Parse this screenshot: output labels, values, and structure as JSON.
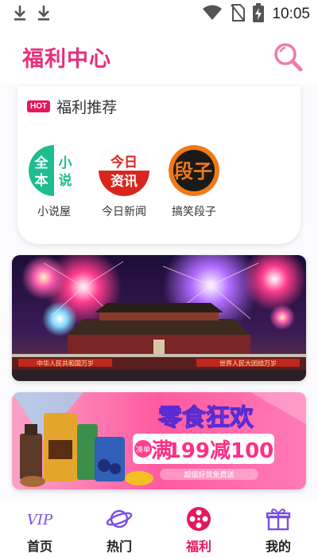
{
  "status_bar": {
    "time": "10:05",
    "icons": [
      "download-icon",
      "download-icon",
      "wifi-icon",
      "no-sim-icon",
      "battery-charging-icon"
    ]
  },
  "header": {
    "title": "福利中心",
    "search_icon": "search-icon"
  },
  "recommend": {
    "badge": "HOT",
    "title": "福利推荐",
    "items": [
      {
        "label": "小说屋",
        "logo_text": [
          "全",
          "小",
          "本",
          "说"
        ]
      },
      {
        "label": "今日新闻",
        "logo_text": [
          "今日",
          "资讯"
        ]
      },
      {
        "label": "搞笑段子",
        "logo_text": [
          "段子"
        ]
      }
    ]
  },
  "banners": [
    {
      "name": "fireworks-banner",
      "gate_sign_left": "中华人民共和国万岁",
      "gate_sign_right": "世界人民大团结万岁"
    },
    {
      "name": "snack-sale-banner",
      "headline": "零食狂欢",
      "deal_prefix": "满",
      "deal_text": "199减100",
      "deal_tag": "凑单",
      "subline": "超值好货免费送"
    }
  ],
  "bottom_nav": [
    {
      "label": "首页",
      "icon_text": "VIP",
      "active": false
    },
    {
      "label": "热门",
      "active": false
    },
    {
      "label": "福利",
      "active": true
    },
    {
      "label": "我的",
      "active": false
    }
  ],
  "colors": {
    "accent": "#ea2d7a",
    "active_nav": "#e4175a",
    "nav_purple": "#7b4fe0"
  }
}
